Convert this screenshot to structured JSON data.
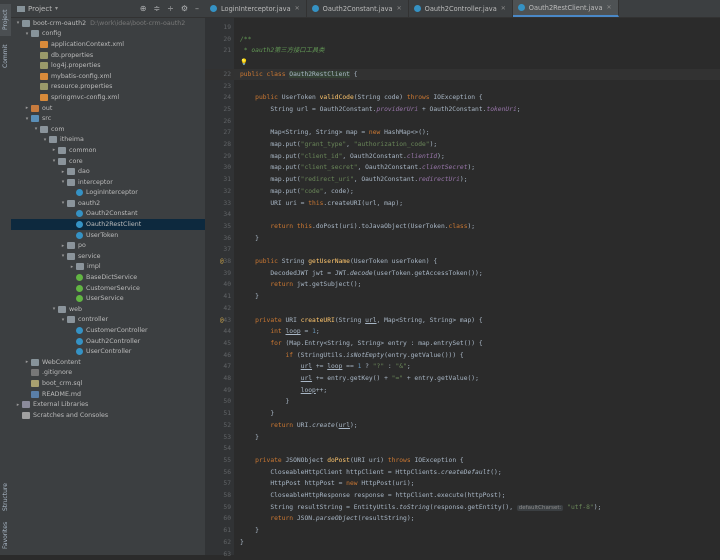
{
  "left_rail": {
    "project_label": "Project",
    "commit_label": "Commit",
    "structure_label": "Structure",
    "favorites_label": "Favorites"
  },
  "project_panel": {
    "title": "Project",
    "tool_icons": [
      "globe-icon",
      "collapse-icon",
      "expand-icon",
      "gear-icon",
      "minimize-icon"
    ],
    "tree": [
      {
        "indent": 0,
        "arrow": "▾",
        "icon": "folder",
        "label": "boot-crm-oauth2",
        "hint": "D:\\work\\idea\\boot-crm-oauth2"
      },
      {
        "indent": 1,
        "arrow": "▾",
        "icon": "folder",
        "label": "config",
        "hint": ""
      },
      {
        "indent": 2,
        "arrow": "",
        "icon": "xml",
        "label": "applicationContext.xml",
        "hint": ""
      },
      {
        "indent": 2,
        "arrow": "",
        "icon": "prop",
        "label": "db.properties",
        "hint": ""
      },
      {
        "indent": 2,
        "arrow": "",
        "icon": "prop",
        "label": "log4j.properties",
        "hint": ""
      },
      {
        "indent": 2,
        "arrow": "",
        "icon": "xml",
        "label": "mybatis-config.xml",
        "hint": ""
      },
      {
        "indent": 2,
        "arrow": "",
        "icon": "prop",
        "label": "resource.properties",
        "hint": ""
      },
      {
        "indent": 2,
        "arrow": "",
        "icon": "xml",
        "label": "springmvc-config.xml",
        "hint": ""
      },
      {
        "indent": 1,
        "arrow": "▸",
        "icon": "folder-exc",
        "label": "out",
        "hint": ""
      },
      {
        "indent": 1,
        "arrow": "▾",
        "icon": "folder-src",
        "label": "src",
        "hint": ""
      },
      {
        "indent": 2,
        "arrow": "▾",
        "icon": "pkg",
        "label": "com",
        "hint": ""
      },
      {
        "indent": 3,
        "arrow": "▾",
        "icon": "pkg",
        "label": "itheima",
        "hint": ""
      },
      {
        "indent": 4,
        "arrow": "▸",
        "icon": "pkg",
        "label": "common",
        "hint": ""
      },
      {
        "indent": 4,
        "arrow": "▾",
        "icon": "pkg",
        "label": "core",
        "hint": ""
      },
      {
        "indent": 5,
        "arrow": "▸",
        "icon": "pkg",
        "label": "dao",
        "hint": ""
      },
      {
        "indent": 5,
        "arrow": "▾",
        "icon": "pkg",
        "label": "interceptor",
        "hint": ""
      },
      {
        "indent": 6,
        "arrow": "",
        "icon": "cls",
        "label": "LoginInterceptor",
        "hint": ""
      },
      {
        "indent": 5,
        "arrow": "▾",
        "icon": "pkg",
        "label": "oauth2",
        "hint": ""
      },
      {
        "indent": 6,
        "arrow": "",
        "icon": "cls",
        "label": "Oauth2Constant",
        "hint": ""
      },
      {
        "indent": 6,
        "arrow": "",
        "icon": "cls",
        "label": "Oauth2RestClient",
        "hint": "",
        "selected": true
      },
      {
        "indent": 6,
        "arrow": "",
        "icon": "cls",
        "label": "UserToken",
        "hint": ""
      },
      {
        "indent": 5,
        "arrow": "▸",
        "icon": "pkg",
        "label": "po",
        "hint": ""
      },
      {
        "indent": 5,
        "arrow": "▾",
        "icon": "pkg",
        "label": "service",
        "hint": ""
      },
      {
        "indent": 6,
        "arrow": "▸",
        "icon": "pkg",
        "label": "impl",
        "hint": ""
      },
      {
        "indent": 6,
        "arrow": "",
        "icon": "iface",
        "label": "BaseDictService",
        "hint": ""
      },
      {
        "indent": 6,
        "arrow": "",
        "icon": "iface",
        "label": "CustomerService",
        "hint": ""
      },
      {
        "indent": 6,
        "arrow": "",
        "icon": "iface",
        "label": "UserService",
        "hint": ""
      },
      {
        "indent": 4,
        "arrow": "▾",
        "icon": "pkg",
        "label": "web",
        "hint": ""
      },
      {
        "indent": 5,
        "arrow": "▾",
        "icon": "pkg",
        "label": "controller",
        "hint": ""
      },
      {
        "indent": 6,
        "arrow": "",
        "icon": "cls",
        "label": "CustomerController",
        "hint": ""
      },
      {
        "indent": 6,
        "arrow": "",
        "icon": "cls",
        "label": "Oauth2Controller",
        "hint": ""
      },
      {
        "indent": 6,
        "arrow": "",
        "icon": "cls",
        "label": "UserController",
        "hint": ""
      },
      {
        "indent": 1,
        "arrow": "▸",
        "icon": "folder",
        "label": "WebContent",
        "hint": ""
      },
      {
        "indent": 1,
        "arrow": "",
        "icon": "misc",
        "label": ".gitignore",
        "hint": ""
      },
      {
        "indent": 1,
        "arrow": "",
        "icon": "sql",
        "label": "boot_crm.sql",
        "hint": ""
      },
      {
        "indent": 1,
        "arrow": "",
        "icon": "md",
        "label": "README.md",
        "hint": ""
      },
      {
        "indent": 0,
        "arrow": "▸",
        "icon": "lib",
        "label": "External Libraries",
        "hint": ""
      },
      {
        "indent": 0,
        "arrow": "",
        "icon": "scr",
        "label": "Scratches and Consoles",
        "hint": ""
      }
    ]
  },
  "tabs": [
    {
      "label": "LoginInterceptor.java",
      "active": false
    },
    {
      "label": "Oauth2Constant.java",
      "active": false
    },
    {
      "label": "Oauth2Controller.java",
      "active": false
    },
    {
      "label": "Oauth2RestClient.java",
      "active": true
    }
  ],
  "editor": {
    "lines": [
      {
        "n": "19",
        "html": ""
      },
      {
        "n": "20",
        "html": "<span class=\"c\">/**</span>"
      },
      {
        "n": "21",
        "html": "<span class=\"c\"> * oauth2第三方接口工具类</span>"
      },
      {
        "n": "",
        "html": "<span class=\"bulb\">💡</span>"
      },
      {
        "n": "22",
        "html": "<span class=\"k\">public class </span><span class=\"hl\">Oauth2RestClient</span> {",
        "cur": true
      },
      {
        "n": "23",
        "html": ""
      },
      {
        "n": "24",
        "html": "    <span class=\"k\">public </span>UserToken <span class=\"f\">validCode</span>(String code) <span class=\"k\">throws </span>IOException {"
      },
      {
        "n": "25",
        "html": "        String url = Oauth2Constant.<span class=\"st\">providerUri</span> + Oauth2Constant.<span class=\"st\">tokenUri</span>;"
      },
      {
        "n": "26",
        "html": ""
      },
      {
        "n": "27",
        "html": "        Map&lt;String, String&gt; map = <span class=\"k\">new </span>HashMap&lt;&gt;();"
      },
      {
        "n": "28",
        "html": "        map.put(<span class=\"s\">\"grant_type\"</span>, <span class=\"s\">\"authorization_code\"</span>);"
      },
      {
        "n": "29",
        "html": "        map.put(<span class=\"s\">\"client_id\"</span>, Oauth2Constant.<span class=\"st\">clientId</span>);"
      },
      {
        "n": "30",
        "html": "        map.put(<span class=\"s\">\"client_secret\"</span>, Oauth2Constant.<span class=\"st\">clientSecret</span>);"
      },
      {
        "n": "31",
        "html": "        map.put(<span class=\"s\">\"redirect_uri\"</span>, Oauth2Constant.<span class=\"st\">redirectUri</span>);"
      },
      {
        "n": "32",
        "html": "        map.put(<span class=\"s\">\"code\"</span>, code);"
      },
      {
        "n": "33",
        "html": "        URI uri = <span class=\"k\">this</span>.createURI(url, map);"
      },
      {
        "n": "34",
        "html": ""
      },
      {
        "n": "35",
        "html": "        <span class=\"k\">return this</span>.doPost(uri).toJavaObject(UserToken.<span class=\"k\">class</span>);"
      },
      {
        "n": "36",
        "html": "    }"
      },
      {
        "n": "37",
        "html": ""
      },
      {
        "n": "38",
        "html": "    <span class=\"k\">public </span>String <span class=\"f\">getUserName</span>(UserToken userToken) {",
        "marker": "@"
      },
      {
        "n": "39",
        "html": "        DecodedJWT jwt = JWT.<span class=\"sti\">decode</span>(userToken.getAccessToken());"
      },
      {
        "n": "40",
        "html": "        <span class=\"k\">return </span>jwt.getSubject();"
      },
      {
        "n": "41",
        "html": "    }"
      },
      {
        "n": "42",
        "html": ""
      },
      {
        "n": "43",
        "html": "    <span class=\"k\">private </span>URI <span class=\"f\">createURI</span>(String <span class=\"u\">url</span>, Map&lt;String, String&gt; map) {",
        "marker": "@"
      },
      {
        "n": "44",
        "html": "        <span class=\"k\">int </span><span class=\"u\">loop</span> = <span class=\"n\">1</span>;"
      },
      {
        "n": "45",
        "html": "        <span class=\"k\">for </span>(Map.Entry&lt;String, String&gt; entry : map.entrySet()) {"
      },
      {
        "n": "46",
        "html": "            <span class=\"k\">if </span>(StringUtils.<span class=\"sti\">isNotEmpty</span>(entry.getValue())) {"
      },
      {
        "n": "47",
        "html": "                <span class=\"u\">url</span> += <span class=\"u\">loop</span> == <span class=\"n\">1</span> ? <span class=\"s\">\"?\"</span> : <span class=\"s\">\"&amp;\"</span>;"
      },
      {
        "n": "48",
        "html": "                <span class=\"u\">url</span> += entry.getKey() + <span class=\"s\">\"=\"</span> + entry.getValue();"
      },
      {
        "n": "49",
        "html": "                <span class=\"u\">loop</span>++;"
      },
      {
        "n": "50",
        "html": "            }"
      },
      {
        "n": "51",
        "html": "        }"
      },
      {
        "n": "52",
        "html": "        <span class=\"k\">return </span>URI.<span class=\"sti\">create</span>(<span class=\"u\">url</span>);"
      },
      {
        "n": "53",
        "html": "    }"
      },
      {
        "n": "54",
        "html": ""
      },
      {
        "n": "55",
        "html": "    <span class=\"k\">private </span>JSONObject <span class=\"f\">doPost</span>(URI uri) <span class=\"k\">throws </span>IOException {"
      },
      {
        "n": "56",
        "html": "        CloseableHttpClient httpClient = HttpClients.<span class=\"sti\">createDefault</span>();"
      },
      {
        "n": "57",
        "html": "        HttpPost httpPost = <span class=\"k\">new </span>HttpPost(uri);"
      },
      {
        "n": "58",
        "html": "        CloseableHttpResponse response = httpClient.execute(httpPost);"
      },
      {
        "n": "59",
        "html": "        String resultString = EntityUtils.<span class=\"sti\">toString</span>(response.getEntity(), <span class=\"inlay\">defaultCharset:</span> <span class=\"s\">\"utf-8\"</span>);"
      },
      {
        "n": "60",
        "html": "        <span class=\"k\">return </span>JSON.<span class=\"sti\">parseObject</span>(resultString);"
      },
      {
        "n": "61",
        "html": "    }"
      },
      {
        "n": "62",
        "html": "}"
      },
      {
        "n": "63",
        "html": ""
      }
    ]
  }
}
